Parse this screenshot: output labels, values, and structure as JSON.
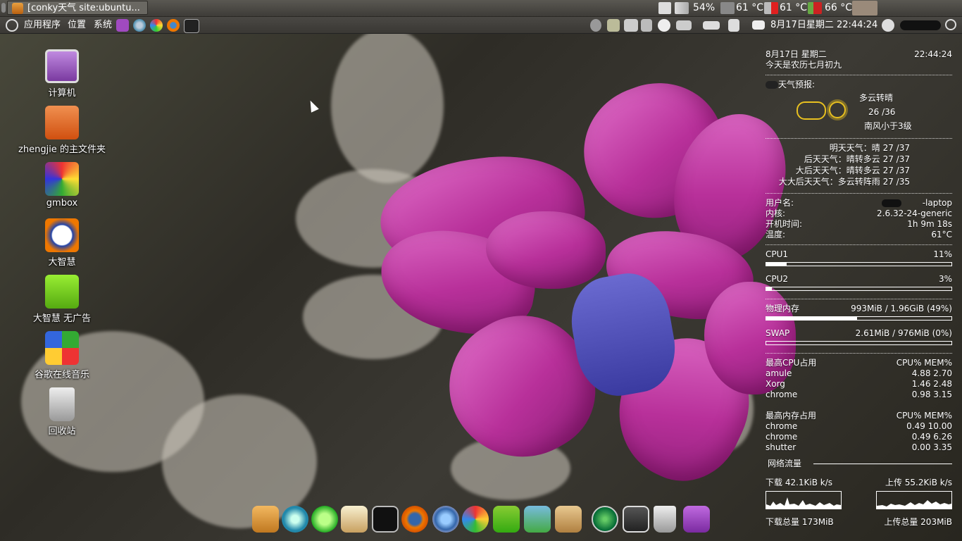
{
  "top_bar": {
    "task_title": "[conky天气 site:ubuntu...",
    "battery_percent": "54%",
    "temps": [
      "61 °C",
      "61 °C",
      "66 °C"
    ]
  },
  "menu_bar": {
    "menus": [
      "应用程序",
      "位置",
      "系统"
    ],
    "clock": "8月17日星期二 22:44:24"
  },
  "desktop": {
    "icons": [
      {
        "label": "计算机",
        "icon": "computer-icon"
      },
      {
        "label": "zhengjie 的主文件夹",
        "icon": "home-folder-icon"
      },
      {
        "label": "gmbox",
        "icon": "gmbox-icon"
      },
      {
        "label": "大智慧",
        "icon": "dzh-icon"
      },
      {
        "label": "大智慧 无广告",
        "icon": "dzh-noad-icon"
      },
      {
        "label": "谷歌在线音乐",
        "icon": "google-music-icon"
      },
      {
        "label": "回收站",
        "icon": "trash-icon"
      }
    ]
  },
  "conky": {
    "date": "8月17日 星期二",
    "time": "22:44:24",
    "lunar": "今天是农历七月初九",
    "weather_title": "天气预报:",
    "today": {
      "desc": "多云转晴",
      "temp": "26 /36",
      "wind": "南风小于3级"
    },
    "forecast": [
      "明天天气：晴 27 /37",
      "后天天气：晴转多云 27 /37",
      "大后天天气：晴转多云 27 /37",
      "大大后天天气：多云转阵雨 27 /35"
    ],
    "sys": [
      {
        "k": "用户名:",
        "v": "-laptop"
      },
      {
        "k": "内核:",
        "v": "2.6.32-24-generic"
      },
      {
        "k": "开机时间:",
        "v": "1h 9m 18s"
      },
      {
        "k": "温度:",
        "v": "61°C"
      }
    ],
    "cpu": [
      {
        "name": "CPU1",
        "value": "11%",
        "fraction": 0.11
      },
      {
        "name": "CPU2",
        "value": "3%",
        "fraction": 0.03
      }
    ],
    "mem": [
      {
        "name": "物理内存",
        "value": "993MiB / 1.96GiB (49%)",
        "fraction": 0.49
      },
      {
        "name": "SWAP",
        "value": "2.61MiB / 976MiB (0%)",
        "fraction": 0.0
      }
    ],
    "top_cpu": {
      "title": "最高CPU占用",
      "cols": "CPU% MEM%",
      "rows": [
        [
          "amule",
          "4.88 2.70"
        ],
        [
          "Xorg",
          "1.46 2.48"
        ],
        [
          "chrome",
          "0.98 3.15"
        ]
      ]
    },
    "top_mem": {
      "title": "最高内存占用",
      "cols": "CPU% MEM%",
      "rows": [
        [
          "chrome",
          "0.49 10.00"
        ],
        [
          "chrome",
          "0.49 6.26"
        ],
        [
          "shutter",
          "0.00 3.35"
        ]
      ]
    },
    "net_title": "网络流量",
    "down": "下载 42.1KiB k/s",
    "up": "上传 55.2KiB k/s",
    "down_total": "下载总量 173MiB",
    "up_total": "上传总量 203MiB"
  },
  "dock": {
    "items": [
      "anchor-icon",
      "blender-icon",
      "media-player-icon",
      "dictionary-icon",
      "terminal-icon",
      "firefox-icon",
      "chromium-icon",
      "picasa-icon",
      "software-center-icon",
      "web-apps-icon",
      "archive-icon",
      "radar-icon",
      "remote-desktop-icon",
      "trash-icon",
      "screen-icon"
    ]
  }
}
